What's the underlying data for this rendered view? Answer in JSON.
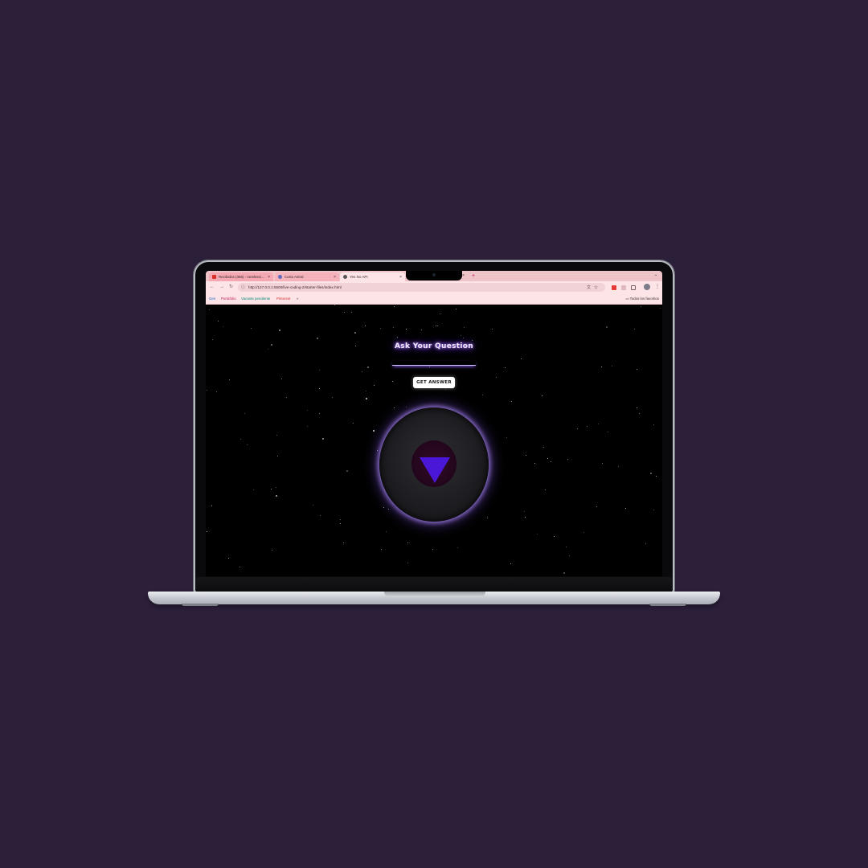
{
  "browser": {
    "tabs": [
      {
        "favicon": "inbox-icon",
        "title": "Recibidos (386) - ionelesci..."
      },
      {
        "favicon": "globe-icon",
        "title": "Carta Astral"
      },
      {
        "favicon": "page-icon",
        "title": "Yes No API"
      }
    ],
    "new_tab_glyph": "+",
    "url": "http://127.0.0.1:5500/live-coding-2/starter-files/index.html",
    "bookmarks": [
      {
        "label": "Gen",
        "color": "#1565c0"
      },
      {
        "label": "Portafolio",
        "color": "#c2185b"
      },
      {
        "label": "Vacante pendiente",
        "color": "#00897b"
      },
      {
        "label": "Pinterest",
        "color": "#d32f2f"
      }
    ],
    "bookmarks_overflow": "»",
    "all_bookmarks_label": "Todos los favoritos"
  },
  "page": {
    "heading": "Ask Your Question",
    "question_value": "",
    "button_label": "GET ANSWER",
    "answer_text": ""
  },
  "colors": {
    "desktop_bg": "#2c1f3a",
    "glow": "#8b5cf6",
    "triangle": "#4a17d8"
  }
}
